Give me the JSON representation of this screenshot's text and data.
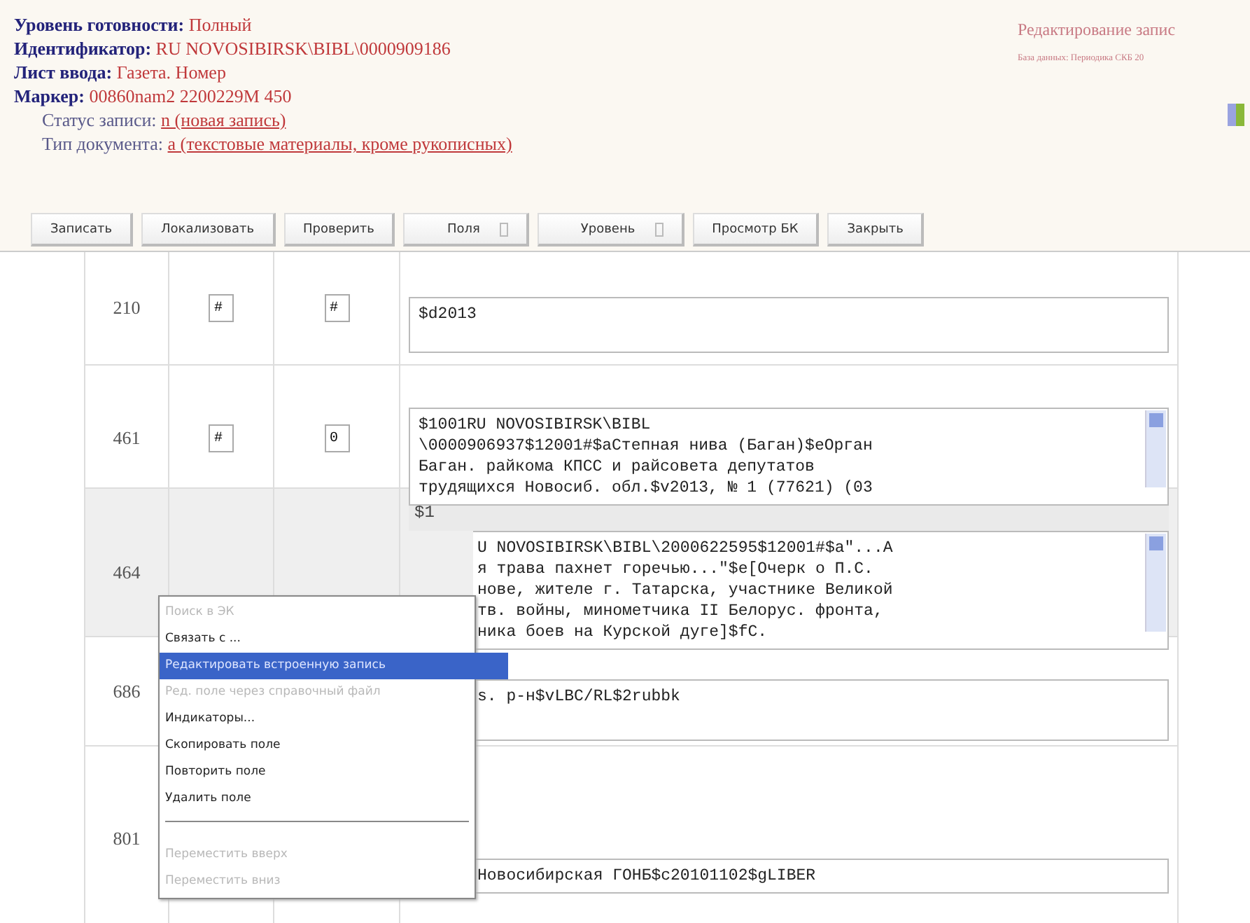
{
  "record_info": [
    {
      "label": "Уровень готовности:",
      "value": "Полный"
    },
    {
      "label": "Идентификатор:",
      "value": "RU NOVOSIBIRSK\\BIBL\\0000909186"
    },
    {
      "label": "Лист ввода:",
      "value": "Газета. Номер"
    },
    {
      "label": "Маркер:",
      "value": "00860nam2 2200229M 450"
    }
  ],
  "record_links": [
    {
      "label": "Статус записи:",
      "value": "n (новая запись)"
    },
    {
      "label": "Тип документа:",
      "value": "a (текстовые материалы, кроме рукописных)"
    }
  ],
  "page_title": "Редактирование запис",
  "database": "База данных: Периодика СКБ 20",
  "toolbar": [
    {
      "label": "Записать",
      "kind": "plain"
    },
    {
      "label": "Локализовать",
      "kind": "plain"
    },
    {
      "label": "Проверить",
      "kind": "plain"
    },
    {
      "label": "Поля",
      "kind": "dropdown"
    },
    {
      "label": "Уровень",
      "kind": "dropdown"
    },
    {
      "label": "Просмотр БК",
      "kind": "plain"
    },
    {
      "label": "Закрыть",
      "kind": "plain"
    }
  ],
  "fields": [
    {
      "tag": "210",
      "ind1": "#",
      "ind2": "#",
      "value": "$d2013",
      "scroll": false,
      "selected": false
    },
    {
      "tag": "461",
      "ind1": "#",
      "ind2": "0",
      "value": "$1001RU NOVOSIBIRSK\\BIBL\n\\0000906937$12001#$aСтепная нива (Баган)$eОрган\nБаган. райкома КПСС и райсовета депутатов\nтрудящихся Новосиб. обл.$v2013, № 1 (77621) (03",
      "scroll": true,
      "selected": false
    },
    {
      "tag": "464",
      "subfield": "$1",
      "value": "U NOVOSIBIRSK\\BIBL\\2000622595$12001#$a\"...А\nя трава пахнет горечью...\"$e[Очерк о П.С.\nнове, жителе г. Татарска, участнике Великой\nтв. войны, минометчика II Белорус. фронта,\nника боев на Курской дуге]$fC.",
      "scroll": true,
      "selected": true
    },
    {
      "tag": "686",
      "value": "s. р-н$vLBC/RL$2rubbk",
      "scroll": false,
      "selected": false
    },
    {
      "tag": "801",
      "value": "Новосибирская ГОНБ$c20101102$gLIBER",
      "scroll": false,
      "selected": false
    }
  ],
  "context_menu": [
    {
      "label": "Поиск в ЭК",
      "kind": "item",
      "disabled": true,
      "selected": false
    },
    {
      "label": "Связать с ...",
      "kind": "item",
      "disabled": false,
      "selected": false
    },
    {
      "label": "Редактировать встроенную запись",
      "kind": "item",
      "disabled": false,
      "selected": true
    },
    {
      "label": "Ред. поле через справочный файл",
      "kind": "item",
      "disabled": true,
      "selected": false
    },
    {
      "label": "Индикаторы...",
      "kind": "item",
      "disabled": false,
      "selected": false
    },
    {
      "label": "Скопировать поле",
      "kind": "item",
      "disabled": false,
      "selected": false
    },
    {
      "label": "Повторить поле",
      "kind": "item",
      "disabled": false,
      "selected": false
    },
    {
      "label": "Удалить поле",
      "kind": "item",
      "disabled": false,
      "selected": false
    },
    {
      "kind": "separator"
    },
    {
      "label": "Переместить вверх",
      "kind": "item",
      "disabled": true,
      "selected": false
    },
    {
      "label": "Переместить вниз",
      "kind": "item",
      "disabled": true,
      "selected": false
    }
  ]
}
